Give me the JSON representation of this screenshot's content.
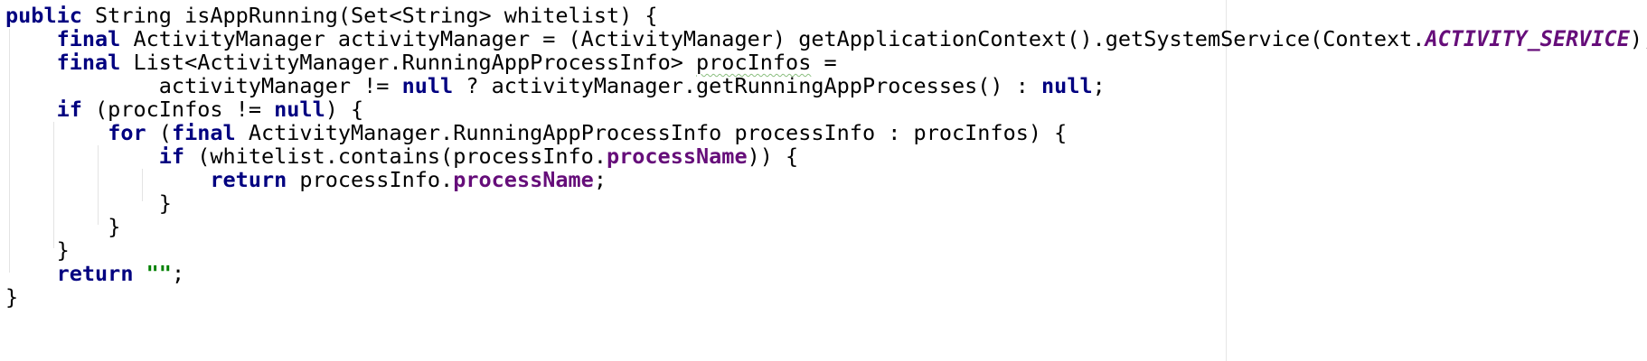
{
  "code": {
    "line1": {
      "t1": "public",
      "t2": " String isAppRunning(Set<String> whitelist) {"
    },
    "line2": {
      "indent": "    ",
      "t1": "final",
      "t2": " ActivityManager activityManager = (ActivityManager) getApplicationContext().getSystemService(Context.",
      "t3": "ACTIVITY_SERVICE",
      "t4": ");"
    },
    "line3": {
      "indent": "    ",
      "t1": "final",
      "t2": " List<ActivityManager.RunningAppProcessInfo> ",
      "t3": "procInfos",
      "t4": " ="
    },
    "line4": {
      "indent": "            ",
      "t1": "activityManager != ",
      "t2": "null",
      "t3": " ? activityManager.getRunningAppProcesses() : ",
      "t4": "null",
      "t5": ";"
    },
    "line5": {
      "indent": "    ",
      "t1": "if",
      "t2": " (procInfos != ",
      "t3": "null",
      "t4": ") {"
    },
    "line6": {
      "indent": "        ",
      "t1": "for",
      "t2": " (",
      "t3": "final",
      "t4": " ActivityManager.RunningAppProcessInfo processInfo : procInfos) {"
    },
    "line7": {
      "indent": "            ",
      "t1": "if",
      "t2": " (whitelist.contains(processInfo.",
      "t3": "processName",
      "t4": ")) {"
    },
    "line8": {
      "indent": "                ",
      "t1": "return",
      "t2": " processInfo.",
      "t3": "processName",
      "t4": ";"
    },
    "line9": {
      "indent": "            ",
      "t1": "}"
    },
    "line10": {
      "indent": "        ",
      "t1": "}"
    },
    "line11": {
      "indent": "    ",
      "t1": "}"
    },
    "line12": {
      "indent": "    ",
      "t1": "return",
      "t2": " ",
      "t3": "\"\"",
      "t4": ";"
    },
    "line13": {
      "t1": "}"
    }
  },
  "colors": {
    "keyword": "#000080",
    "field": "#660e7a",
    "string": "#008000",
    "warning_underline": "#8bbf80",
    "guide": "#e3e3e3",
    "right_margin": "#e6e6e6"
  }
}
